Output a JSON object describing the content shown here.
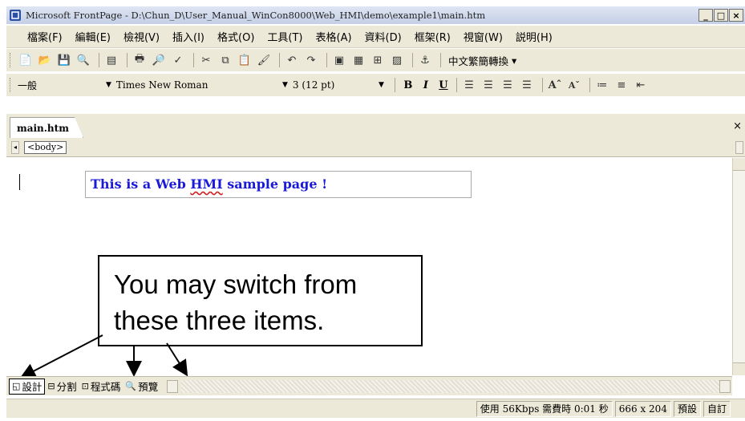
{
  "window": {
    "title": "Microsoft FrontPage - D:\\Chun_D\\User_Manual_WinCon8000\\Web_HMI\\demo\\example1\\main.htm",
    "controls": [
      "_",
      "□",
      "×"
    ]
  },
  "menubar": {
    "items": [
      "檔案(F)",
      "編輯(E)",
      "檢視(V)",
      "插入(I)",
      "格式(O)",
      "工具(T)",
      "表格(A)",
      "資料(D)",
      "框架(R)",
      "視窗(W)",
      "説明(H)"
    ]
  },
  "toolbar_standard": {
    "convert_label": "中文繁簡轉換"
  },
  "toolbar_format": {
    "style": "一般",
    "font": "Times New Roman",
    "size": "3 (12 pt)",
    "bold": "B",
    "italic": "I",
    "underline": "U"
  },
  "document_tab": {
    "label": "main.htm",
    "close": "×"
  },
  "quick_tag": {
    "tag": "<body>"
  },
  "editor": {
    "headline_prefix": "This is a Web ",
    "headline_hmi": "HMI",
    "headline_suffix": " sample page !"
  },
  "callout": {
    "line1": "You may switch from",
    "line2": "these three items."
  },
  "view_tabs": {
    "design": "設計",
    "split": "分割",
    "code": "程式碼",
    "preview": "預覽"
  },
  "statusbar": {
    "download": "使用 56Kbps 需費時 0:01 秒",
    "size": "666 x 204",
    "mode": "預設",
    "custom": "自訂"
  },
  "colors": {
    "chrome": "#ece9d8",
    "headline_text": "#1a1ad8",
    "titlebar": "#c4d0e6"
  }
}
